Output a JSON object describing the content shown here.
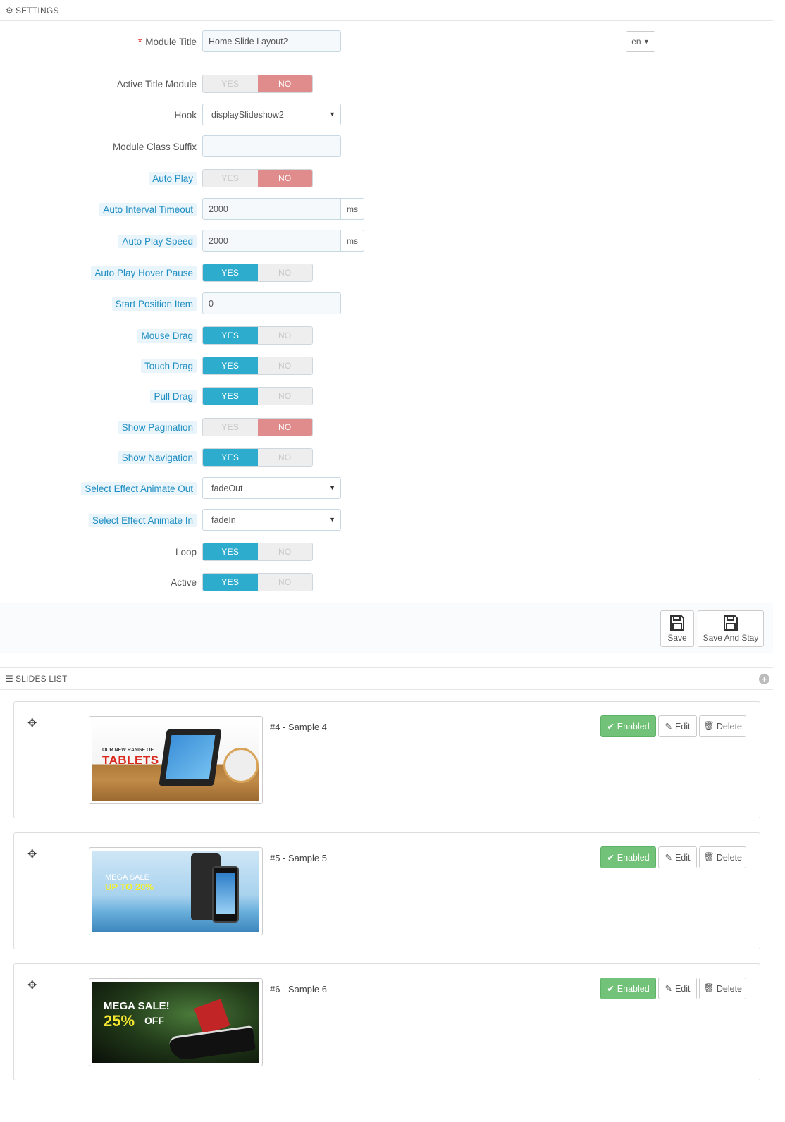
{
  "settings": {
    "heading": "SETTINGS",
    "module_title_label": "Module Title",
    "module_title_value": "Home Slide Layout2",
    "lang": "en",
    "active_title_module_label": "Active Title Module",
    "hook_label": "Hook",
    "hook_value": "displaySlideshow2",
    "class_suffix_label": "Module Class Suffix",
    "class_suffix_value": "",
    "auto_play_label": "Auto Play",
    "auto_interval_label": "Auto Interval Timeout",
    "auto_interval_value": "2000",
    "auto_speed_label": "Auto Play Speed",
    "auto_speed_value": "2000",
    "unit_ms": "ms",
    "hover_pause_label": "Auto Play Hover Pause",
    "start_position_label": "Start Position Item",
    "start_position_value": "0",
    "mouse_drag_label": "Mouse Drag",
    "touch_drag_label": "Touch Drag",
    "pull_drag_label": "Pull Drag",
    "show_pagination_label": "Show Pagination",
    "show_navigation_label": "Show Navigation",
    "effect_out_label": "Select Effect Animate Out",
    "effect_out_value": "fadeOut",
    "effect_in_label": "Select Effect Animate In",
    "effect_in_value": "fadeIn",
    "loop_label": "Loop",
    "active_label": "Active",
    "yes": "YES",
    "no": "NO",
    "save_label": "Save",
    "save_stay_label": "Save And Stay"
  },
  "slides_list": {
    "heading": "SLIDES LIST",
    "enabled_label": "Enabled",
    "edit_label": "Edit",
    "delete_label": "Delete",
    "items": [
      {
        "title": "#4 - Sample 4",
        "img_small": "OUR NEW RANGE OF",
        "img_big": "TABLETS"
      },
      {
        "title": "#5 - Sample 5",
        "img_small": "MEGA SALE",
        "img_big": "UP TO 20%"
      },
      {
        "title": "#6 - Sample 6",
        "img_small": "MEGA SALE!",
        "img_big": "25%",
        "img_extra": "OFF"
      }
    ]
  },
  "colors": {
    "toggle_yes": "#2eacce",
    "toggle_no": "#e08c8c",
    "enabled_green": "#72c279",
    "hint_label": "#1f8ec2"
  }
}
